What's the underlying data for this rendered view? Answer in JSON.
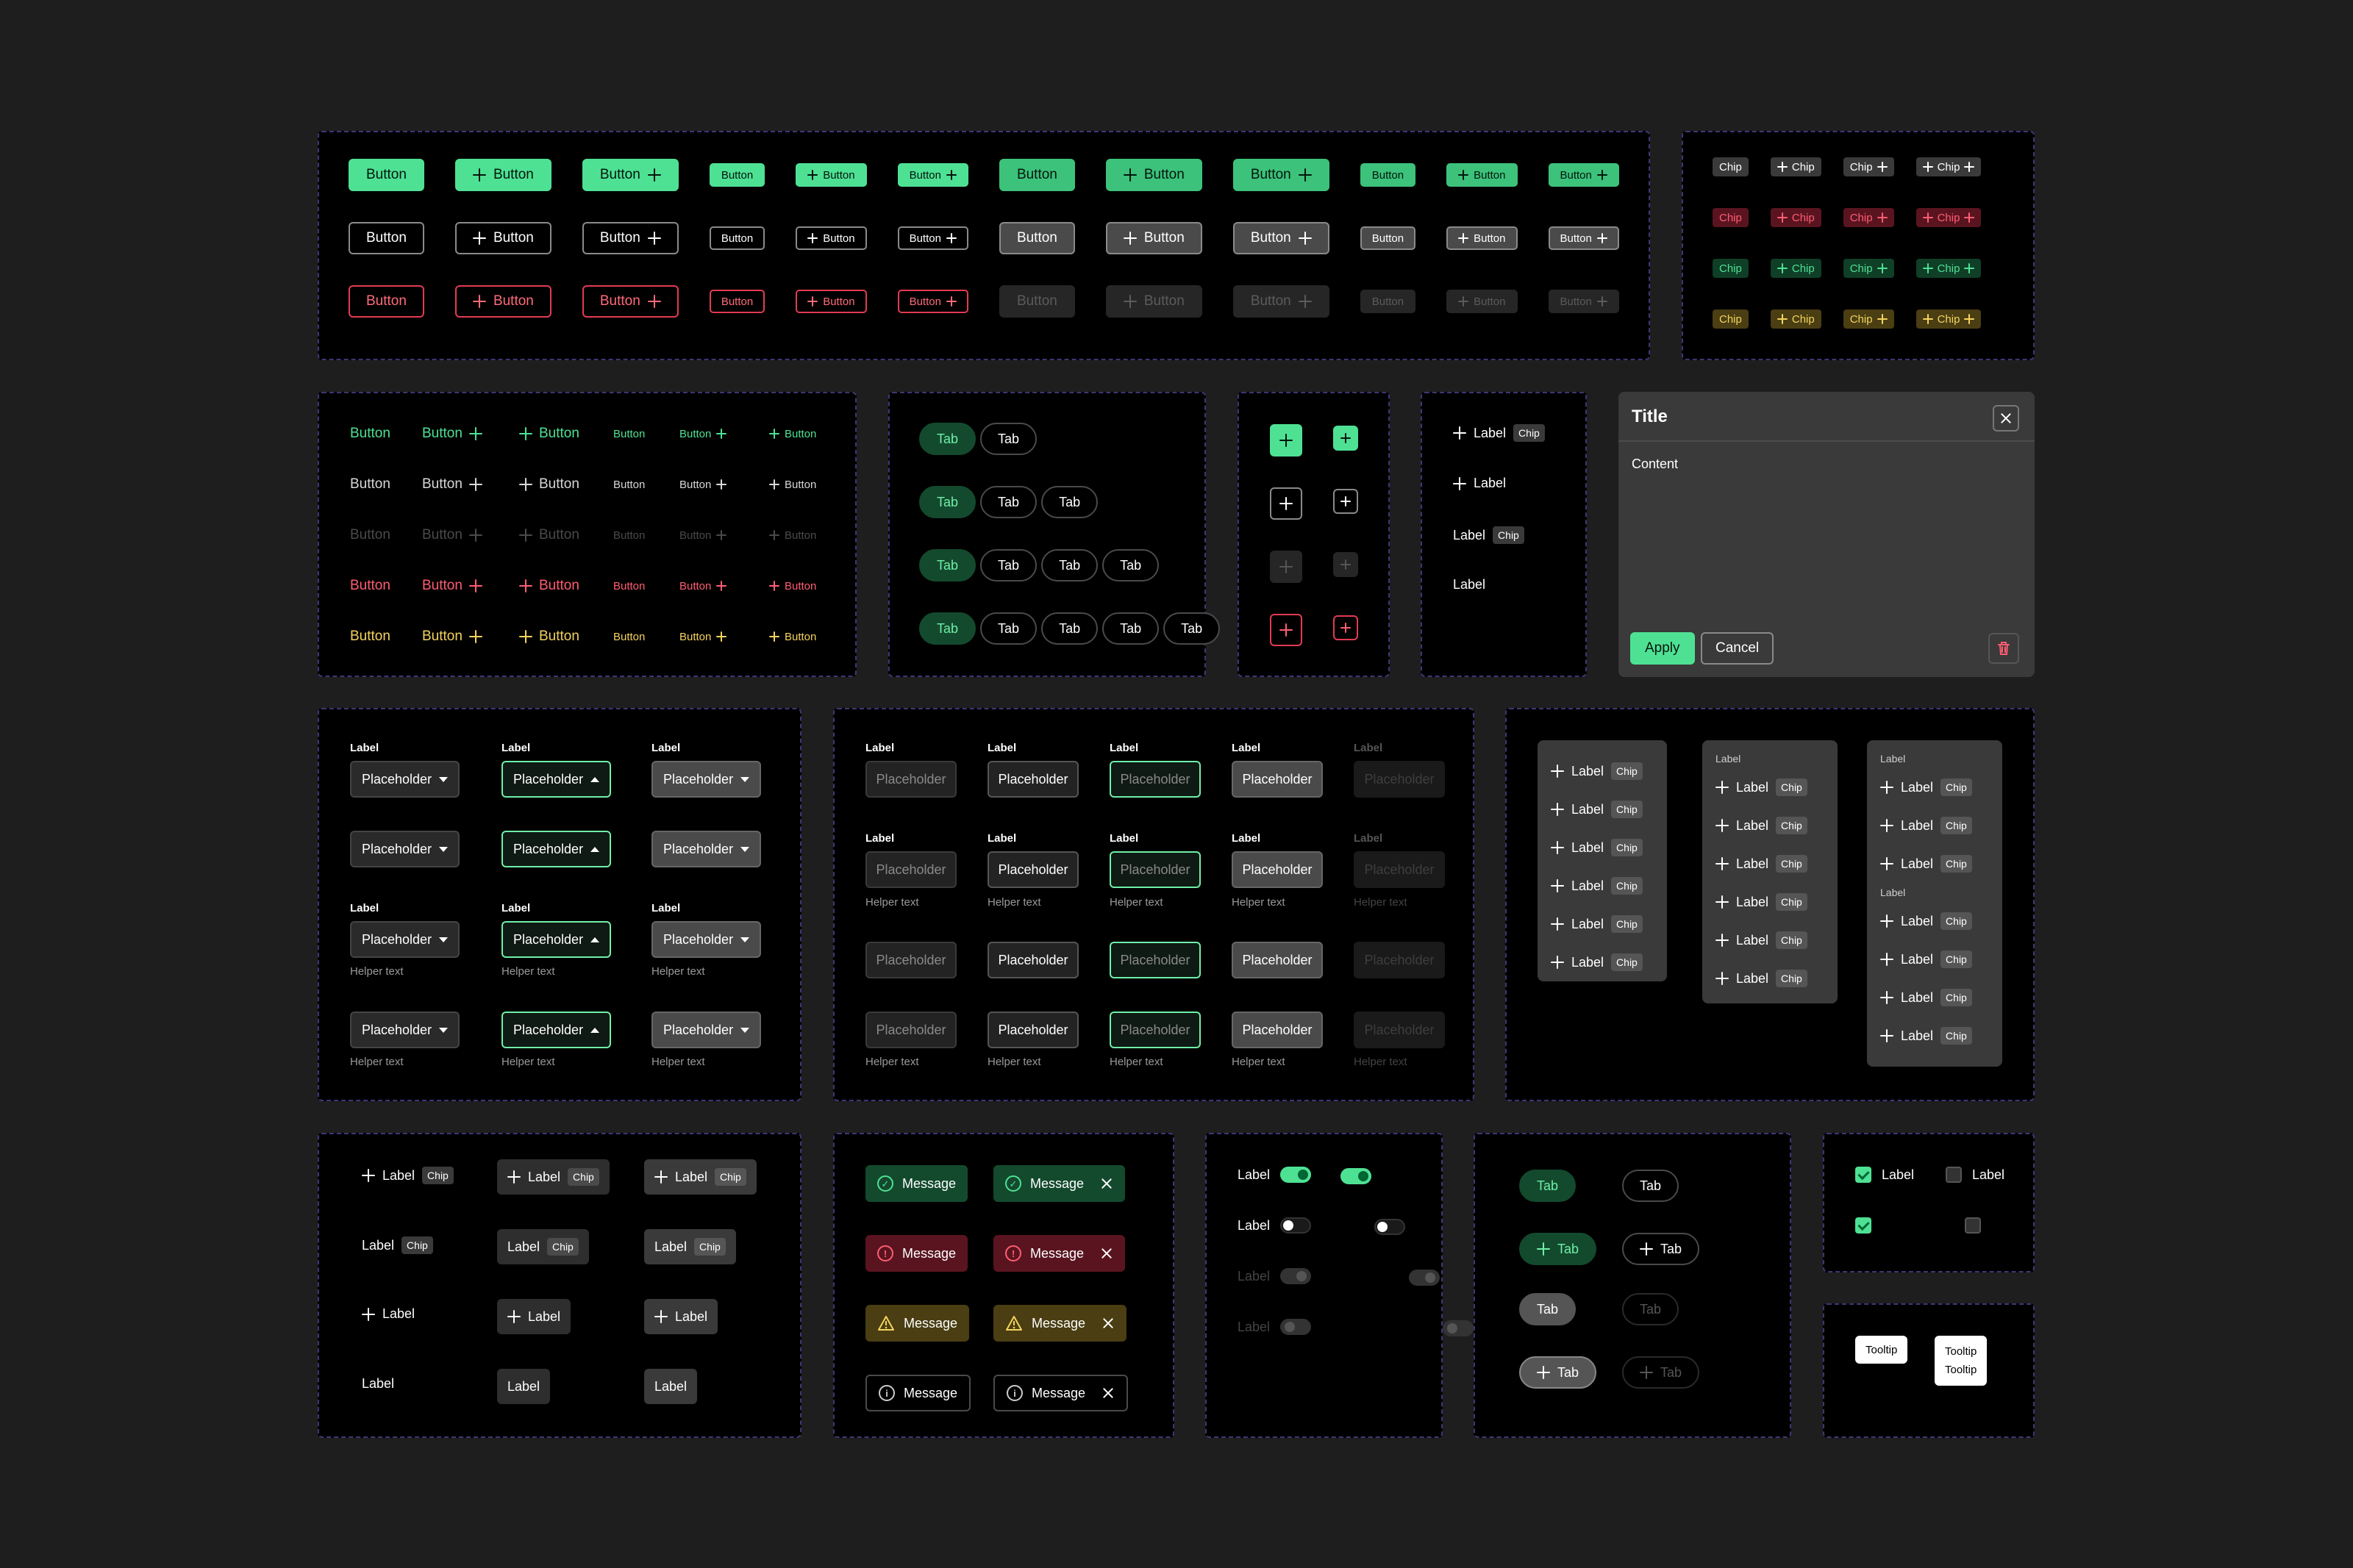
{
  "labels": {
    "button": "Button",
    "chip": "Chip",
    "tab": "Tab",
    "label": "Label",
    "placeholder": "Placeholder",
    "helper": "Helper text",
    "message": "Message",
    "tooltip": "Tooltip"
  },
  "dialog": {
    "title": "Title",
    "content": "Content",
    "apply": "Apply",
    "cancel": "Cancel"
  },
  "colors": {
    "background": "#1e1e1e",
    "panel": "#000000",
    "panel_border": "#3f3576",
    "accent_green": "#4ee194",
    "danger_red": "#e23b52",
    "warning_yellow": "#f4d35e",
    "neutral_gray": "#4a4a4a"
  },
  "icons": [
    "plus-icon",
    "caret-down-icon",
    "caret-up-icon",
    "close-icon",
    "trash-icon",
    "check-circle-icon",
    "error-circle-icon",
    "warning-triangle-icon",
    "info-circle-icon",
    "checkbox-icon",
    "toggle-icon"
  ]
}
